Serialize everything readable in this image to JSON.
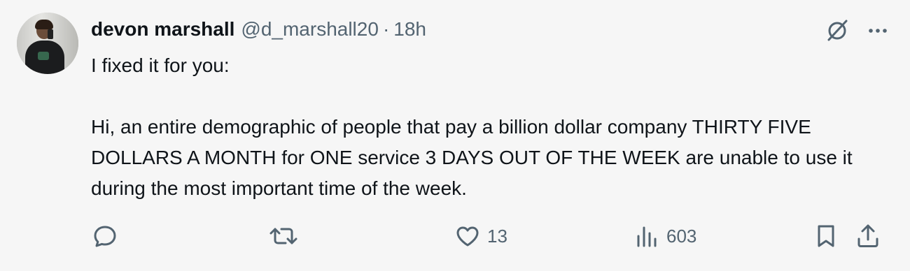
{
  "tweet": {
    "display_name": "devon marshall",
    "handle": "@d_marshall20",
    "separator": "·",
    "time": "18h",
    "line1": "I fixed it for you:",
    "line2": "Hi, an entire demographic of people that pay a billion dollar company THIRTY FIVE DOLLARS A MONTH for ONE service 3 DAYS OUT OF THE WEEK are unable to use it during the most important time of the week."
  },
  "actions": {
    "likes": "13",
    "views": "603"
  },
  "colors": {
    "background": "#f6f6f6",
    "text": "#0f1419",
    "muted": "#536471"
  },
  "icons": [
    "grok-icon",
    "more-icon",
    "reply-icon",
    "retweet-icon",
    "like-icon",
    "views-icon",
    "bookmark-icon",
    "share-icon"
  ]
}
